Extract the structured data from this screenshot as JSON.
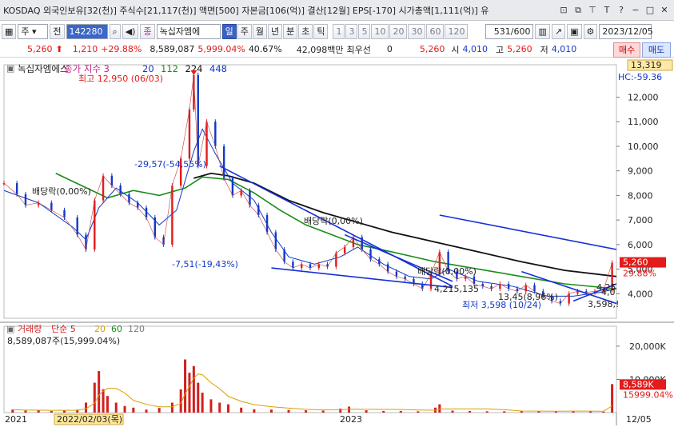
{
  "window": {
    "title": "KOSDAQ 외국인보유[32(천)] 주식수[21,117(천)] 액면[500] 자본금[106(억)] 결산[12월] EPS[-170] 시가총액[1,111(억)] 유",
    "icons": [
      "restore-icon",
      "copy-icon",
      "pin-icon",
      "text-icon",
      "help-icon",
      "minimize-icon",
      "maximize-icon",
      "close-icon"
    ],
    "icon_glyphs": [
      "⊡",
      "⧉",
      "⊤",
      "T",
      "?",
      "−",
      "□",
      "✕"
    ]
  },
  "toolbar": {
    "type_select": "주",
    "full_button": "전",
    "code_input": "142280",
    "stock_name": "녹십자엠에",
    "periods": [
      "일",
      "주",
      "월",
      "년",
      "분",
      "초",
      "틱"
    ],
    "active_period": "일",
    "minute_values": [
      "1",
      "3",
      "5",
      "10",
      "20",
      "30",
      "60",
      "120"
    ],
    "count": "531",
    "count_total": "/600",
    "date": "2023/12/05"
  },
  "price": {
    "current": "5,260",
    "change": "1,210",
    "change_pct": "+29.88%",
    "volume": "8,589,087",
    "volume_pct": "5,999.04%",
    "turnover": "40.67%",
    "amount": "42,098백만",
    "preferred_label": "최우선",
    "preferred_value": "0",
    "bid": "5,260",
    "open_label": "시",
    "open": "4,010",
    "high_label": "고",
    "high": "5,260",
    "low_label": "저",
    "low": "4,010",
    "buy_label": "매수",
    "sell_label": "매도"
  },
  "chart_data": {
    "type": "line",
    "stock": "녹십자엠에스",
    "legend": {
      "price": "종가 지수 3",
      "ma": [
        "20",
        "112",
        "224",
        "448"
      ],
      "ma_colors": [
        "#1238c8",
        "#1a8c1a",
        "#111111",
        "#1238c8"
      ]
    },
    "y_ticks": [
      "12,000",
      "11,000",
      "10,000",
      "9,000",
      "8,000",
      "7,000",
      "6,000",
      "5,000",
      "4,000"
    ],
    "ylim": [
      3000,
      13319
    ],
    "top_label": "13,319",
    "hc_label": "HC:-59.36",
    "current_label": "5,260",
    "current_pct": "29.88%",
    "x_labels": [
      {
        "text": "2021",
        "pos": 0.005
      },
      {
        "text": "2022/02/03(목)",
        "pos": 0.125
      },
      {
        "text": "2023",
        "pos": 0.56
      }
    ],
    "last_x_label": "12/05",
    "annotations": {
      "high": "최고 12,950 (06/03)",
      "drop1": "-29,57(-54,55%)",
      "div1": "배당락(0,00%)",
      "drop2": "-7,51(-19,43%)",
      "div2": "배당락(0,00%)",
      "div3": "배당락(0,00%)",
      "pct3": "4,215,135",
      "low_label": "최저 3,598 (10/24)",
      "pct4": "13,45(8,96%)",
      "lowval": "3,598,!",
      "r1": "4,25",
      "r2": "4,0"
    },
    "price_series": [
      {
        "x": 0,
        "y": 8500
      },
      {
        "x": 3,
        "y": 8050
      },
      {
        "x": 5,
        "y": 7600
      },
      {
        "x": 8,
        "y": 7700
      },
      {
        "x": 11,
        "y": 7400
      },
      {
        "x": 14,
        "y": 7100
      },
      {
        "x": 17,
        "y": 6400
      },
      {
        "x": 19,
        "y": 5800
      },
      {
        "x": 21,
        "y": 7800
      },
      {
        "x": 23,
        "y": 8800
      },
      {
        "x": 25,
        "y": 8400
      },
      {
        "x": 27,
        "y": 8050
      },
      {
        "x": 29,
        "y": 7700
      },
      {
        "x": 31,
        "y": 7500
      },
      {
        "x": 33,
        "y": 7100
      },
      {
        "x": 35,
        "y": 6300
      },
      {
        "x": 37,
        "y": 6000
      },
      {
        "x": 39,
        "y": 8400
      },
      {
        "x": 41,
        "y": 9500
      },
      {
        "x": 43,
        "y": 11500
      },
      {
        "x": 44,
        "y": 12900
      },
      {
        "x": 45,
        "y": 9200
      },
      {
        "x": 47,
        "y": 11000
      },
      {
        "x": 49,
        "y": 10000
      },
      {
        "x": 51,
        "y": 8700
      },
      {
        "x": 53,
        "y": 8000
      },
      {
        "x": 55,
        "y": 8200
      },
      {
        "x": 57,
        "y": 7600
      },
      {
        "x": 59,
        "y": 7200
      },
      {
        "x": 61,
        "y": 6500
      },
      {
        "x": 63,
        "y": 5800
      },
      {
        "x": 65,
        "y": 5300
      },
      {
        "x": 67,
        "y": 5050
      },
      {
        "x": 69,
        "y": 5200
      },
      {
        "x": 71,
        "y": 5050
      },
      {
        "x": 73,
        "y": 5200
      },
      {
        "x": 75,
        "y": 5100
      },
      {
        "x": 77,
        "y": 5650
      },
      {
        "x": 79,
        "y": 5900
      },
      {
        "x": 81,
        "y": 6300
      },
      {
        "x": 83,
        "y": 5800
      },
      {
        "x": 85,
        "y": 5400
      },
      {
        "x": 87,
        "y": 5200
      },
      {
        "x": 89,
        "y": 4900
      },
      {
        "x": 91,
        "y": 4700
      },
      {
        "x": 93,
        "y": 4600
      },
      {
        "x": 95,
        "y": 4400
      },
      {
        "x": 97,
        "y": 4200
      },
      {
        "x": 99,
        "y": 4800
      },
      {
        "x": 101,
        "y": 5700
      },
      {
        "x": 103,
        "y": 4900
      },
      {
        "x": 105,
        "y": 4600
      },
      {
        "x": 107,
        "y": 4700
      },
      {
        "x": 109,
        "y": 4400
      },
      {
        "x": 111,
        "y": 4300
      },
      {
        "x": 113,
        "y": 4200
      },
      {
        "x": 115,
        "y": 4400
      },
      {
        "x": 117,
        "y": 4200
      },
      {
        "x": 119,
        "y": 4100
      },
      {
        "x": 121,
        "y": 4350
      },
      {
        "x": 123,
        "y": 4100
      },
      {
        "x": 125,
        "y": 3900
      },
      {
        "x": 127,
        "y": 3700
      },
      {
        "x": 129,
        "y": 3600
      },
      {
        "x": 131,
        "y": 4000
      },
      {
        "x": 133,
        "y": 4100
      },
      {
        "x": 135,
        "y": 4050
      },
      {
        "x": 137,
        "y": 4100
      },
      {
        "x": 139,
        "y": 4150
      },
      {
        "x": 141,
        "y": 5260
      }
    ],
    "ma20": [
      {
        "x": 0,
        "y": 8200
      },
      {
        "x": 8,
        "y": 7700
      },
      {
        "x": 16,
        "y": 6700
      },
      {
        "x": 19,
        "y": 6200
      },
      {
        "x": 22,
        "y": 7500
      },
      {
        "x": 26,
        "y": 8300
      },
      {
        "x": 31,
        "y": 7700
      },
      {
        "x": 36,
        "y": 6800
      },
      {
        "x": 40,
        "y": 7400
      },
      {
        "x": 44,
        "y": 9800
      },
      {
        "x": 46,
        "y": 10700
      },
      {
        "x": 49,
        "y": 9700
      },
      {
        "x": 53,
        "y": 8500
      },
      {
        "x": 58,
        "y": 7800
      },
      {
        "x": 62,
        "y": 6500
      },
      {
        "x": 66,
        "y": 5500
      },
      {
        "x": 72,
        "y": 5200
      },
      {
        "x": 78,
        "y": 5500
      },
      {
        "x": 82,
        "y": 5900
      },
      {
        "x": 88,
        "y": 5200
      },
      {
        "x": 94,
        "y": 4700
      },
      {
        "x": 99,
        "y": 4600
      },
      {
        "x": 103,
        "y": 5000
      },
      {
        "x": 110,
        "y": 4500
      },
      {
        "x": 118,
        "y": 4300
      },
      {
        "x": 126,
        "y": 3900
      },
      {
        "x": 132,
        "y": 3900
      },
      {
        "x": 138,
        "y": 4050
      },
      {
        "x": 142,
        "y": 4200
      }
    ],
    "ma112": [
      {
        "x": 12,
        "y": 8900
      },
      {
        "x": 18,
        "y": 8400
      },
      {
        "x": 24,
        "y": 7900
      },
      {
        "x": 30,
        "y": 8200
      },
      {
        "x": 36,
        "y": 8000
      },
      {
        "x": 42,
        "y": 8300
      },
      {
        "x": 46,
        "y": 8750
      },
      {
        "x": 52,
        "y": 8650
      },
      {
        "x": 58,
        "y": 8100
      },
      {
        "x": 64,
        "y": 7400
      },
      {
        "x": 70,
        "y": 6800
      },
      {
        "x": 76,
        "y": 6400
      },
      {
        "x": 82,
        "y": 6000
      },
      {
        "x": 90,
        "y": 5700
      },
      {
        "x": 100,
        "y": 5300
      },
      {
        "x": 110,
        "y": 5000
      },
      {
        "x": 120,
        "y": 4700
      },
      {
        "x": 130,
        "y": 4400
      },
      {
        "x": 142,
        "y": 4200
      }
    ],
    "ma224": [
      {
        "x": 44,
        "y": 8700
      },
      {
        "x": 48,
        "y": 8900
      },
      {
        "x": 52,
        "y": 8800
      },
      {
        "x": 58,
        "y": 8500
      },
      {
        "x": 66,
        "y": 7800
      },
      {
        "x": 74,
        "y": 7300
      },
      {
        "x": 82,
        "y": 6900
      },
      {
        "x": 90,
        "y": 6500
      },
      {
        "x": 100,
        "y": 6100
      },
      {
        "x": 110,
        "y": 5700
      },
      {
        "x": 120,
        "y": 5300
      },
      {
        "x": 130,
        "y": 4950
      },
      {
        "x": 142,
        "y": 4700
      }
    ],
    "trendlines": [
      {
        "x1": 50,
        "y1": 9200,
        "x2": 104,
        "y2": 4300
      },
      {
        "x1": 62,
        "y1": 5050,
        "x2": 104,
        "y2": 4250
      },
      {
        "x1": 101,
        "y1": 7200,
        "x2": 142,
        "y2": 5800
      },
      {
        "x1": 79,
        "y1": 6400,
        "x2": 104,
        "y2": 4500
      },
      {
        "x1": 120,
        "y1": 4900,
        "x2": 142,
        "y2": 3600
      },
      {
        "x1": 132,
        "y1": 3700,
        "x2": 142,
        "y2": 4400
      }
    ],
    "xmax": 142,
    "volume": {
      "legend": [
        "거래량",
        "단순 5",
        "20",
        "60",
        "120"
      ],
      "legend_colors": [
        "#d21f1f",
        "#d21f1f",
        "#d8a000",
        "#1a8c1a",
        "#7a7a7a"
      ],
      "summary": "8,589,087주(15,999.04%)",
      "y_ticks": [
        "20,000K",
        "10,000K"
      ],
      "ylim": [
        0,
        26000
      ],
      "current_label": "8,589K",
      "current_pct": "15999.04%",
      "values": [
        {
          "x": 2,
          "v": 900
        },
        {
          "x": 5,
          "v": 600
        },
        {
          "x": 8,
          "v": 800
        },
        {
          "x": 11,
          "v": 500
        },
        {
          "x": 14,
          "v": 700
        },
        {
          "x": 17,
          "v": 900
        },
        {
          "x": 19,
          "v": 3000
        },
        {
          "x": 21,
          "v": 9000
        },
        {
          "x": 22,
          "v": 12500
        },
        {
          "x": 23,
          "v": 7000
        },
        {
          "x": 24,
          "v": 5000
        },
        {
          "x": 26,
          "v": 3000
        },
        {
          "x": 28,
          "v": 2000
        },
        {
          "x": 30,
          "v": 1500
        },
        {
          "x": 33,
          "v": 900
        },
        {
          "x": 36,
          "v": 1400
        },
        {
          "x": 39,
          "v": 3000
        },
        {
          "x": 41,
          "v": 7000
        },
        {
          "x": 42,
          "v": 16000
        },
        {
          "x": 43,
          "v": 12000
        },
        {
          "x": 44,
          "v": 14000
        },
        {
          "x": 45,
          "v": 9000
        },
        {
          "x": 46,
          "v": 6000
        },
        {
          "x": 48,
          "v": 4000
        },
        {
          "x": 50,
          "v": 3000
        },
        {
          "x": 52,
          "v": 2500
        },
        {
          "x": 55,
          "v": 1500
        },
        {
          "x": 58,
          "v": 1000
        },
        {
          "x": 62,
          "v": 900
        },
        {
          "x": 66,
          "v": 800
        },
        {
          "x": 70,
          "v": 700
        },
        {
          "x": 74,
          "v": 600
        },
        {
          "x": 78,
          "v": 1200
        },
        {
          "x": 80,
          "v": 1800
        },
        {
          "x": 84,
          "v": 700
        },
        {
          "x": 88,
          "v": 500
        },
        {
          "x": 92,
          "v": 500
        },
        {
          "x": 96,
          "v": 400
        },
        {
          "x": 100,
          "v": 1500
        },
        {
          "x": 101,
          "v": 2500
        },
        {
          "x": 104,
          "v": 600
        },
        {
          "x": 108,
          "v": 500
        },
        {
          "x": 112,
          "v": 400
        },
        {
          "x": 116,
          "v": 400
        },
        {
          "x": 120,
          "v": 500
        },
        {
          "x": 124,
          "v": 400
        },
        {
          "x": 128,
          "v": 400
        },
        {
          "x": 132,
          "v": 500
        },
        {
          "x": 136,
          "v": 400
        },
        {
          "x": 139,
          "v": 300
        },
        {
          "x": 141,
          "v": 8589
        }
      ]
    }
  }
}
